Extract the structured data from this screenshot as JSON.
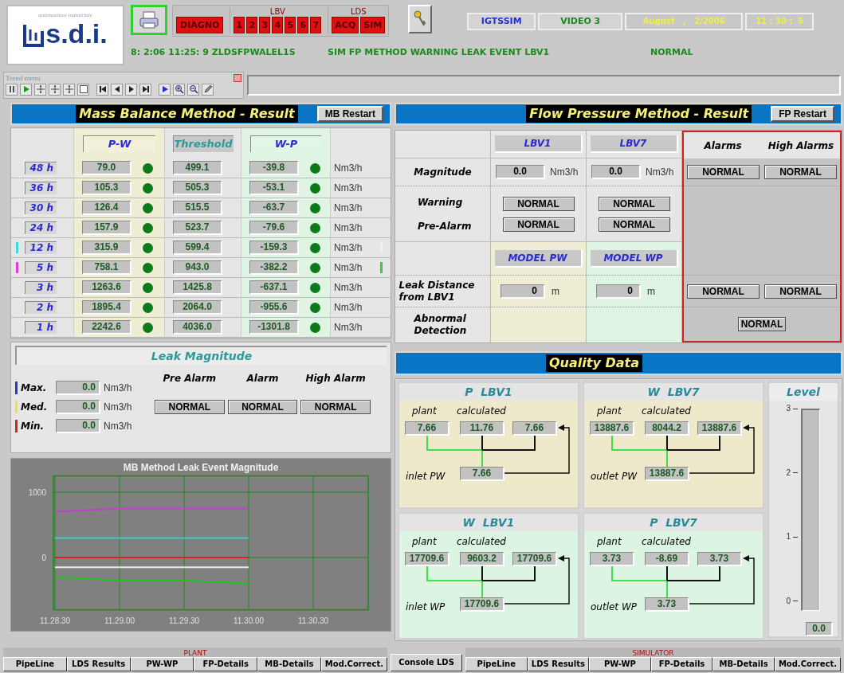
{
  "header": {
    "logo_tagline": "automazione industriale",
    "logo_text": "s.d.i.",
    "diag_button": "DIAGNO",
    "lbv": {
      "label": "LBV",
      "buttons": [
        "1",
        "2",
        "3",
        "4",
        "5",
        "6",
        "7"
      ]
    },
    "lds": {
      "label": "LDS",
      "buttons": [
        "ACQ",
        "SIM"
      ]
    },
    "system": "IGTSSIM",
    "video": "VIDEO 3",
    "date": "August   ,   2/2006",
    "time": "11 : 30 :  5",
    "status_line": [
      "8: 2:06 11:25: 9 ZLDSFPWALEL1S",
      "SIM FP METHOD WARNING LEAK EVENT LBV1",
      "NORMAL"
    ]
  },
  "trend_menu": {
    "title": "Trend menu"
  },
  "mb": {
    "title": "Mass Balance Method - Result",
    "restart": "MB Restart",
    "columns": [
      "P-W",
      "Threshold",
      "W-P"
    ],
    "rows": [
      {
        "period": "48 h",
        "pw": "79.0",
        "pw_ok": true,
        "threshold": "499.1",
        "wp": "-39.8",
        "wp_ok": true,
        "unit": "Nm3/h"
      },
      {
        "period": "36 h",
        "pw": "105.3",
        "pw_ok": true,
        "threshold": "505.3",
        "wp": "-53.1",
        "wp_ok": true,
        "unit": "Nm3/h"
      },
      {
        "period": "30 h",
        "pw": "126.4",
        "pw_ok": true,
        "threshold": "515.5",
        "wp": "-63.7",
        "wp_ok": true,
        "unit": "Nm3/h"
      },
      {
        "period": "24 h",
        "pw": "157.9",
        "pw_ok": true,
        "threshold": "523.7",
        "wp": "-79.6",
        "wp_ok": true,
        "unit": "Nm3/h"
      },
      {
        "period": "12 h",
        "pw": "315.9",
        "pw_ok": true,
        "threshold": "599.4",
        "wp": "-159.3",
        "wp_ok": true,
        "unit": "Nm3/h",
        "markers": [
          {
            "color": "#40d8e0"
          },
          {
            "color": "#f0f0f0"
          }
        ]
      },
      {
        "period": "5 h",
        "pw": "758.1",
        "pw_ok": true,
        "threshold": "943.0",
        "wp": "-382.2",
        "wp_ok": true,
        "unit": "Nm3/h",
        "markers": [
          {
            "color": "#e040d0"
          },
          {
            "color": "#30d030"
          }
        ]
      },
      {
        "period": "3 h",
        "pw": "1263.6",
        "pw_ok": true,
        "threshold": "1425.8",
        "wp": "-637.1",
        "wp_ok": true,
        "unit": "Nm3/h"
      },
      {
        "period": "2 h",
        "pw": "1895.4",
        "pw_ok": true,
        "threshold": "2064.0",
        "wp": "-955.6",
        "wp_ok": true,
        "unit": "Nm3/h"
      },
      {
        "period": "1 h",
        "pw": "2242.6",
        "pw_ok": true,
        "threshold": "4036.0",
        "wp": "-1301.8",
        "wp_ok": true,
        "unit": "Nm3/h"
      }
    ]
  },
  "leak": {
    "title": "Leak Magnitude",
    "columns": [
      "Pre Alarm",
      "Alarm",
      "High Alarm"
    ],
    "statuses": [
      "NORMAL",
      "NORMAL",
      "NORMAL"
    ],
    "rows": [
      {
        "label": "Max.",
        "color": "#2838c8",
        "value": "0.0",
        "unit": "Nm3/h"
      },
      {
        "label": "Med.",
        "color": "#f0e040",
        "value": "0.0",
        "unit": "Nm3/h"
      },
      {
        "label": "Min.",
        "color": "#e02020",
        "value": "0.0",
        "unit": "Nm3/h"
      }
    ]
  },
  "trend": {
    "chart_data": {
      "type": "line",
      "title": "MB Method Leak Event Magnitude",
      "categories": [
        "11.28.30",
        "11.29.00",
        "11.29.30",
        "11.30.00",
        "11.30.30"
      ],
      "ylim": [
        -800,
        1250
      ],
      "grid": true,
      "yticks": [
        0,
        1000
      ],
      "series": [
        {
          "color": "#c040d0",
          "values": [
            700,
            750,
            750,
            750,
            null
          ]
        },
        {
          "color": "#40c8c8",
          "values": [
            300,
            300,
            300,
            300,
            null
          ]
        },
        {
          "color": "#e02020",
          "values": [
            0,
            0,
            0,
            0,
            null
          ]
        },
        {
          "color": "#e8e8e8",
          "values": [
            -150,
            -150,
            -150,
            -150,
            null
          ]
        },
        {
          "color": "#20c020",
          "values": [
            -300,
            -350,
            -350,
            -400,
            null
          ]
        }
      ]
    }
  },
  "fp": {
    "title": "Flow Pressure Method - Result",
    "restart": "FP Restart",
    "columns": [
      "LBV1",
      "LBV7"
    ],
    "alarm_columns": [
      "Alarms",
      "High Alarms"
    ],
    "magnitude": {
      "label": "Magnitude",
      "values": [
        {
          "value": "0.0",
          "unit": "Nm3/h"
        },
        {
          "value": "0.0",
          "unit": "Nm3/h"
        }
      ],
      "alarms": [
        "NORMAL",
        "NORMAL"
      ]
    },
    "warning": {
      "label": "Warning",
      "values": [
        "NORMAL",
        "NORMAL"
      ]
    },
    "pre_alarm": {
      "label": "Pre-Alarm",
      "values": [
        "NORMAL",
        "NORMAL"
      ]
    },
    "models": [
      "MODEL PW",
      "MODEL WP"
    ],
    "leak_distance": {
      "label": "Leak Distance from LBV1",
      "values": [
        {
          "value": "0",
          "unit": "m"
        },
        {
          "value": "0",
          "unit": "m"
        }
      ],
      "alarms": [
        "NORMAL",
        "NORMAL"
      ]
    },
    "abnormal": {
      "label": "Abnormal Detection",
      "status": "NORMAL"
    }
  },
  "quality": {
    "title": "Quality Data",
    "panels": [
      {
        "title": "P  LBV1",
        "color": "#efe9cc",
        "labels": [
          "plant",
          "calculated"
        ],
        "values": [
          "7.66",
          "11.76",
          "7.66"
        ],
        "output_label": "inlet PW",
        "output": "7.66",
        "plant_selected": true
      },
      {
        "title": "W  LBV7",
        "color": "#efe9cc",
        "labels": [
          "plant",
          "calculated"
        ],
        "values": [
          "13887.6",
          "8044.2",
          "13887.6"
        ],
        "output_label": "outlet PW",
        "output": "13887.6",
        "plant_selected": true
      },
      {
        "title": "W  LBV1",
        "color": "#dcf4e2",
        "labels": [
          "plant",
          "calculated"
        ],
        "values": [
          "17709.6",
          "9603.2",
          "17709.6"
        ],
        "output_label": "inlet WP",
        "output": "17709.6",
        "plant_selected": true
      },
      {
        "title": "P  LBV7",
        "color": "#dcf4e2",
        "labels": [
          "plant",
          "calculated"
        ],
        "values": [
          "3.73",
          "-8.69",
          "3.73"
        ],
        "output_label": "outlet WP",
        "output": "3.73",
        "plant_selected": true
      }
    ],
    "level": {
      "title": "Level",
      "ticks": [
        "3",
        "2",
        "1",
        "0"
      ],
      "level": 0,
      "value": "0.0"
    }
  },
  "footer": {
    "plant": {
      "label": "PLANT",
      "tabs": [
        "PipeLine",
        "LDS Results",
        "PW-WP",
        "FP-Details",
        "MB-Details",
        "Mod.Correct."
      ]
    },
    "console": "Console LDS",
    "simulator": {
      "label": "SIMULATOR",
      "tabs": [
        "PipeLine",
        "LDS Results",
        "PW-WP",
        "FP-Details",
        "MB-Details",
        "Mod.Correct."
      ]
    }
  }
}
